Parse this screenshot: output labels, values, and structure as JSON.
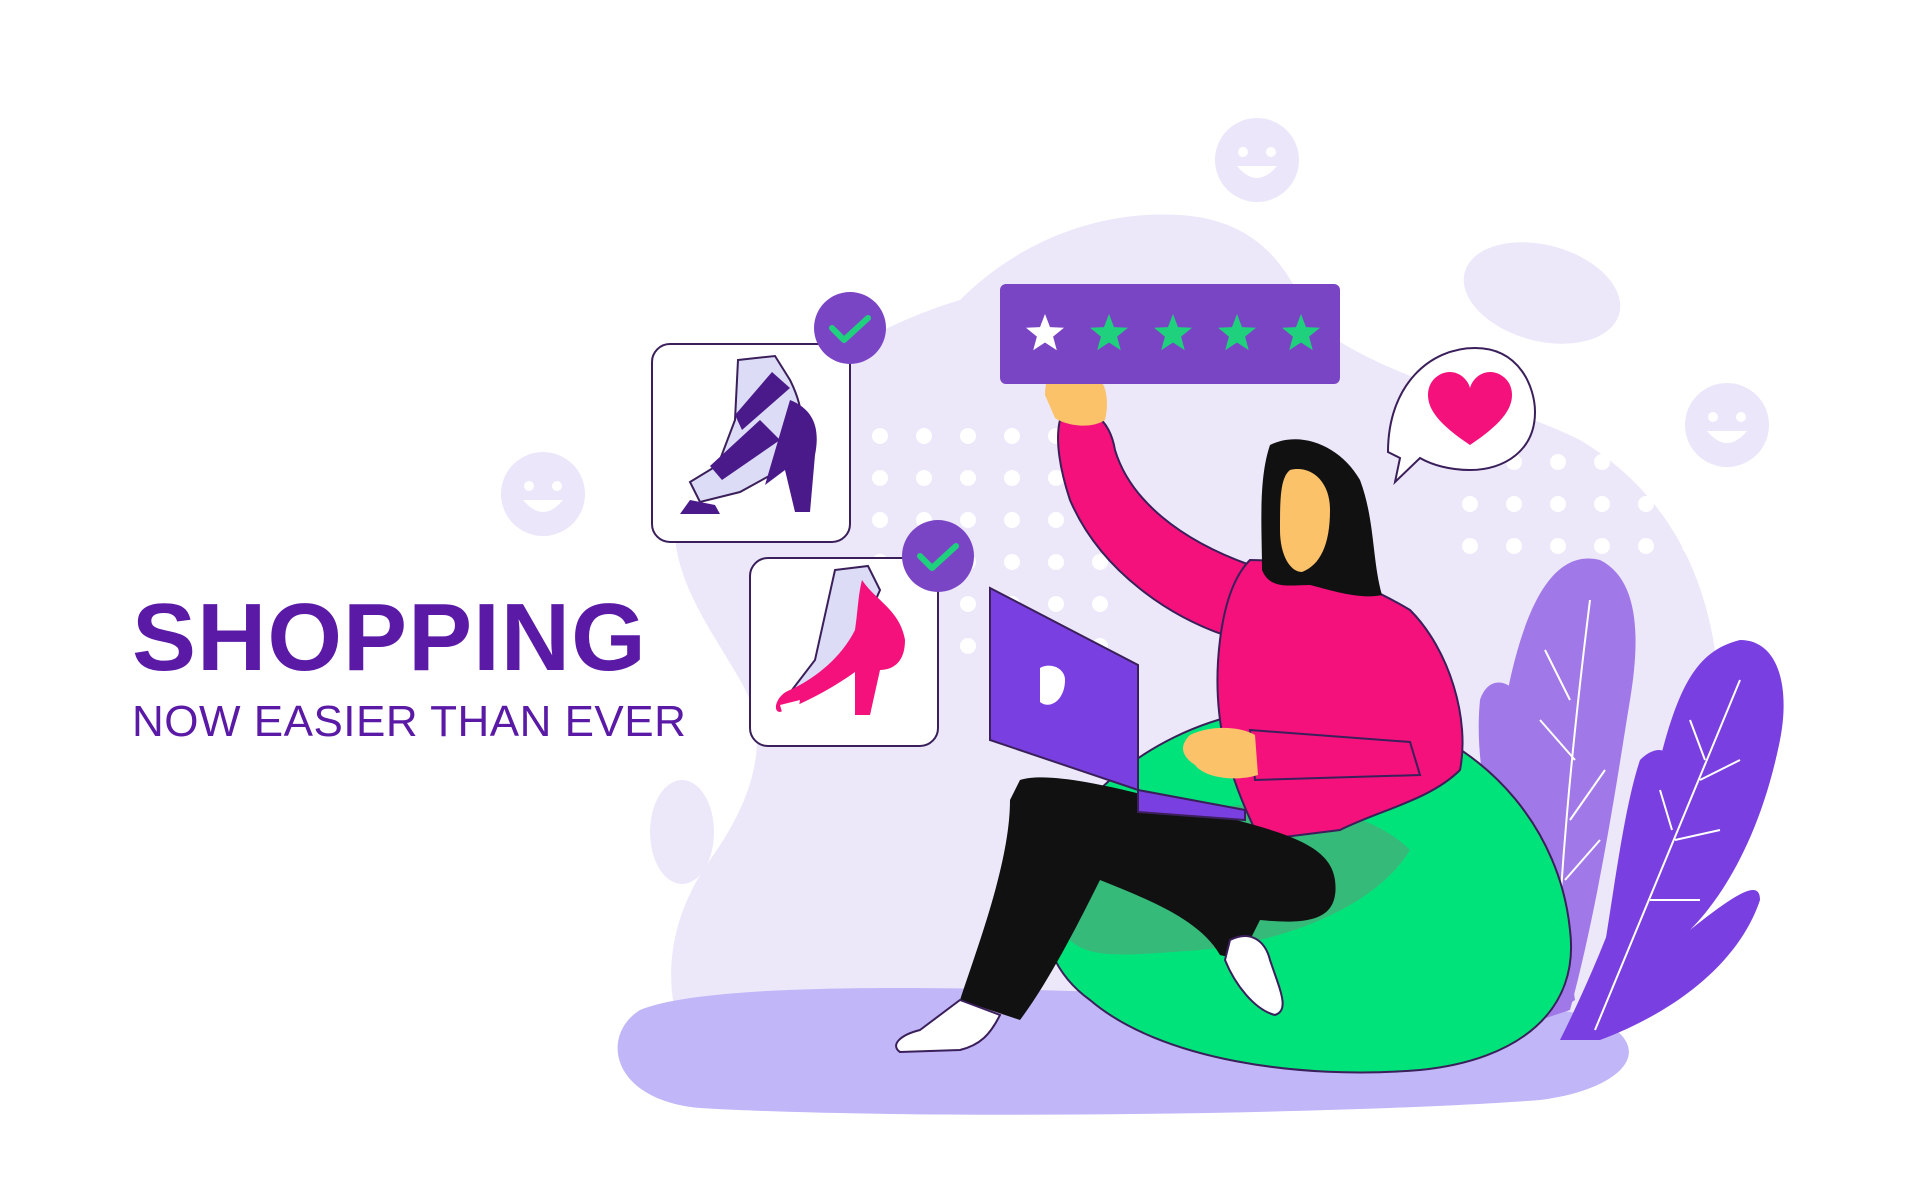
{
  "banner": {
    "title": "SHOPPING",
    "subtitle": "NOW EASIER THAN EVER"
  },
  "colors": {
    "brand_purple": "#5a1aa6",
    "rating_bar": "#7a45c4",
    "star_filled": "#1fd17d",
    "star_empty": "#ffffff",
    "sweater_pink": "#f4117c",
    "beanbag_green": "#00e37a",
    "laptop_purple": "#7a3fe0",
    "blob_lavender": "#ece8fa",
    "floor_lavender": "#c1b6f8",
    "check_badge": "#7a45c4",
    "heart_pink": "#f4117c"
  },
  "rating": {
    "max_stars": 5,
    "highlighted_star": 1
  },
  "icons": [
    "check-icon",
    "heart-icon",
    "star-icon",
    "smiley-icon",
    "shoe-icon",
    "laptop-icon"
  ]
}
